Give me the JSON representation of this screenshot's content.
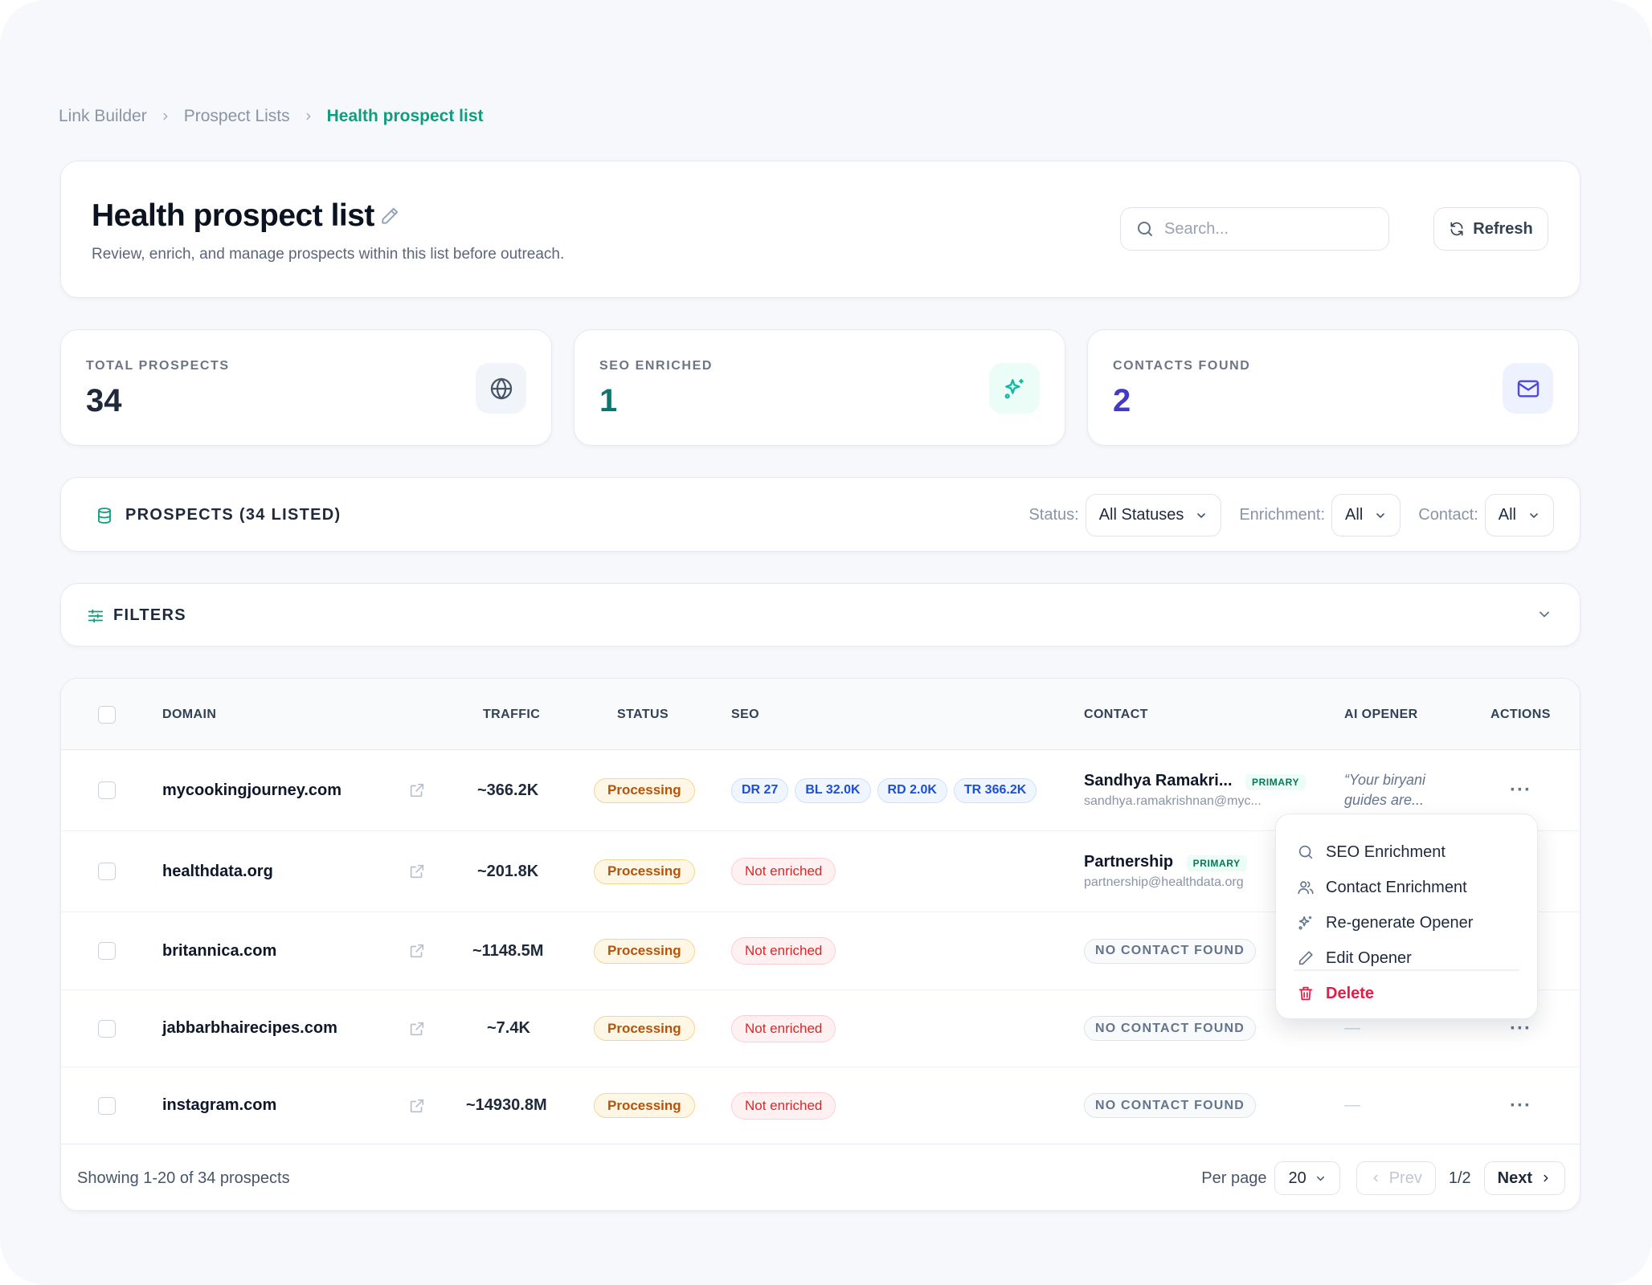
{
  "breadcrumb": [
    "Link Builder",
    "Prospect Lists",
    "Health prospect list"
  ],
  "header": {
    "title": "Health prospect list",
    "subtitle": "Review, enrich, and manage prospects within this list before outreach.",
    "search_placeholder": "Search...",
    "refresh_label": "Refresh"
  },
  "stats": [
    {
      "label": "TOTAL PROSPECTS",
      "value": "34",
      "icon": "globe-icon",
      "color": "#0f172a"
    },
    {
      "label": "SEO ENRICHED",
      "value": "1",
      "icon": "sparkles-icon",
      "color": "#0f766e"
    },
    {
      "label": "CONTACTS FOUND",
      "value": "2",
      "icon": "mail-icon",
      "color": "#4338ca"
    }
  ],
  "prospects_bar": {
    "title": "PROSPECTS (34 LISTED)",
    "status_label": "Status:",
    "status_value": "All Statuses",
    "enrichment_label": "Enrichment:",
    "enrichment_value": "All",
    "contact_label": "Contact:",
    "contact_value": "All"
  },
  "filters": {
    "title": "FILTERS"
  },
  "table": {
    "columns": [
      "DOMAIN",
      "TRAFFIC",
      "STATUS",
      "SEO",
      "CONTACT",
      "AI OPENER",
      "ACTIONS"
    ],
    "rows": [
      {
        "domain": "mycookingjourney.com",
        "traffic": "~366.2K",
        "status": "Processing",
        "seo": [
          "DR 27",
          "BL 32.0K",
          "RD 2.0K",
          "TR 366.2K"
        ],
        "contact_name": "Sandhya Ramakri...",
        "contact_badge": "PRIMARY",
        "contact_email": "sandhya.ramakrishnan@myc...",
        "opener_line1": "“Your biryani",
        "opener_line2": "guides are..."
      },
      {
        "domain": "healthdata.org",
        "traffic": "~201.8K",
        "status": "Processing",
        "seo_status": "Not enriched",
        "contact_name": "Partnership",
        "contact_badge": "PRIMARY",
        "contact_email": "partnership@healthdata.org"
      },
      {
        "domain": "britannica.com",
        "traffic": "~1148.5M",
        "status": "Processing",
        "seo_status": "Not enriched",
        "contact_status": "NO CONTACT FOUND"
      },
      {
        "domain": "jabbarbhairecipes.com",
        "traffic": "~7.4K",
        "status": "Processing",
        "seo_status": "Not enriched",
        "contact_status": "NO CONTACT FOUND",
        "opener": "—"
      },
      {
        "domain": "instagram.com",
        "traffic": "~14930.8M",
        "status": "Processing",
        "seo_status": "Not enriched",
        "contact_status": "NO CONTACT FOUND",
        "opener": "—"
      }
    ],
    "actions_label": "···"
  },
  "footer": {
    "showing": "Showing 1-20 of 34 prospects",
    "per_page_label": "Per page",
    "per_page_value": "20",
    "prev_label": "Prev",
    "page_indicator": "1/2",
    "next_label": "Next"
  },
  "action_menu": {
    "items": [
      "SEO Enrichment",
      "Contact Enrichment",
      "Re-generate Opener",
      "Edit Opener"
    ],
    "delete_label": "Delete"
  },
  "colors": {
    "accent": "#0f9d7f",
    "processing": "#b45309",
    "not_enriched": "#dc2626",
    "seo_pill": "#1d4ed8",
    "danger": "#e11d48"
  }
}
